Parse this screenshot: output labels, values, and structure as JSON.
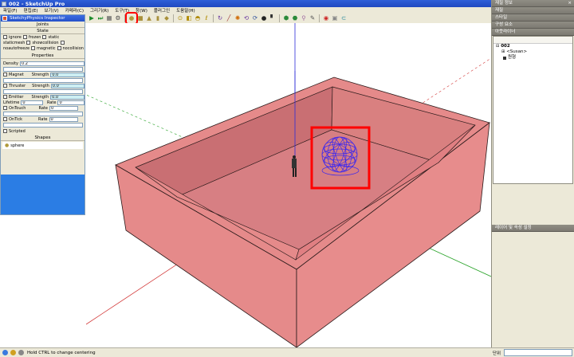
{
  "window": {
    "title": "002 - SketchUp Pro"
  },
  "menu": {
    "items": [
      "파일(F)",
      "편집(E)",
      "보기(V)",
      "카메라(C)",
      "그리기(R)",
      "도구(T)",
      "창(W)",
      "플러그인",
      "도움말(H)"
    ]
  },
  "toolbar": {
    "icons": [
      "play-icon",
      "stop-icon",
      "reset-icon",
      "joint-icon",
      "sphere-icon",
      "box-icon",
      "cone-icon",
      "cylinder-icon",
      "connector-icon",
      "fixed-joint-icon",
      "slider-icon",
      "servo-icon",
      "piston-icon",
      "rotate-icon",
      "line-tool-icon",
      "circle-joint-icon",
      "spring-icon",
      "corkscrew-icon",
      "ball-joint-icon",
      "magnet-icon",
      "gear-joint-icon",
      "gyro-icon",
      "motor-icon",
      "thruster-icon",
      "record-icon",
      "camera-icon",
      "link-icon"
    ],
    "highlighted_icon": "sphere-icon"
  },
  "plugin_panel": {
    "title": "SketchyPhysics Inspector",
    "joints_label": "Joints",
    "state_label": "State",
    "state_checks": [
      [
        "ignore",
        "frozen",
        "static"
      ],
      [
        "staticmesh",
        "showcollision"
      ],
      [
        "noautofreeze",
        "magnetic",
        "nocollision"
      ]
    ],
    "properties_label": "Properties",
    "density_label": "Density",
    "density_value": "0.2",
    "magnet_label": "Magnet",
    "strength_label": "Strength",
    "magnet_strength": "0.0",
    "thruster_label": "Thruster",
    "thruster_strength": "0.0",
    "emitter_label": "Emitter",
    "emitter_strength": "0.0",
    "lifetime_label": "Lifetime",
    "lifetime_value": "0",
    "rate_label": "Rate",
    "rate_value": "0",
    "ontouch_label": "OnTouch",
    "ontouch_rate": "0",
    "ontick_label": "OnTick",
    "ontick_rate": "0",
    "scripted_label": "Scripted",
    "shapes_label": "Shapes",
    "shape_value": "sphere"
  },
  "tray": {
    "panels": [
      "재질 정보",
      "재질",
      "스타일",
      "구성 요소",
      "아웃라이너"
    ],
    "outliner": {
      "root": "002",
      "children": [
        "<Susan>",
        "원형"
      ]
    },
    "bottom_panel": "레이어 및 속성 설정"
  },
  "status": {
    "hint": "Hold CTRL to change centering",
    "unit_label": "단위"
  },
  "colors": {
    "model_fill": "#e58a8a",
    "model_dark": "#c96f73",
    "sphere_line": "#3d28ee",
    "highlight": "#ff0000",
    "axis_green": "#29a329",
    "axis_red": "#d33a3a",
    "axis_blue": "#2c2cd8"
  }
}
